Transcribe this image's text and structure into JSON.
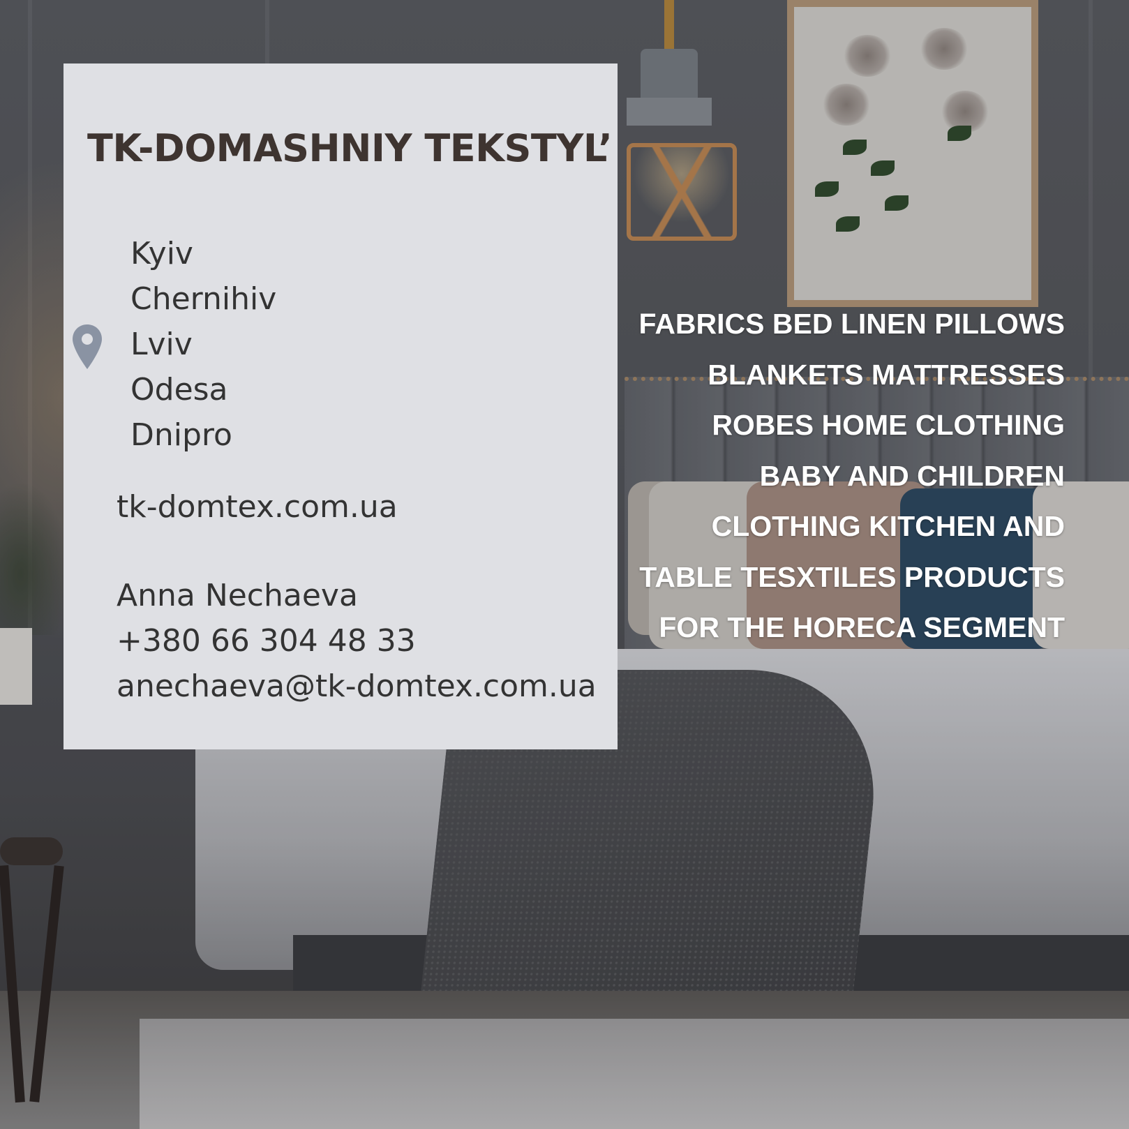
{
  "card": {
    "company_name": "TK-DOMASHNIY TEKSTYL’",
    "location_icon": "map-pin-icon",
    "cities": [
      "Kyiv",
      "Chernihiv",
      "Lviv",
      "Odesa",
      "Dnipro"
    ],
    "website": "tk-domtex.com.ua",
    "contact": {
      "name": "Anna Nechaeva",
      "phone": "+380 66 304 48 33",
      "email": "anechaeva@tk-domtex.com.ua"
    }
  },
  "products": {
    "lines": [
      "FABRICS BED LINEN PILLOWS",
      "BLANKETS MATTRESSES",
      "ROBES HOME CLOTHING",
      "BABY AND CHILDREN",
      "CLOTHING KITCHEN AND",
      "TABLE TESXTILES PRODUCTS",
      "FOR THE HORECA SEGMENT"
    ]
  },
  "colors": {
    "card_background": "#dfe0e4",
    "brand_text": "#3e3430",
    "body_text": "#333333",
    "pin_icon": "#8a93a3",
    "products_text": "#ffffff"
  }
}
